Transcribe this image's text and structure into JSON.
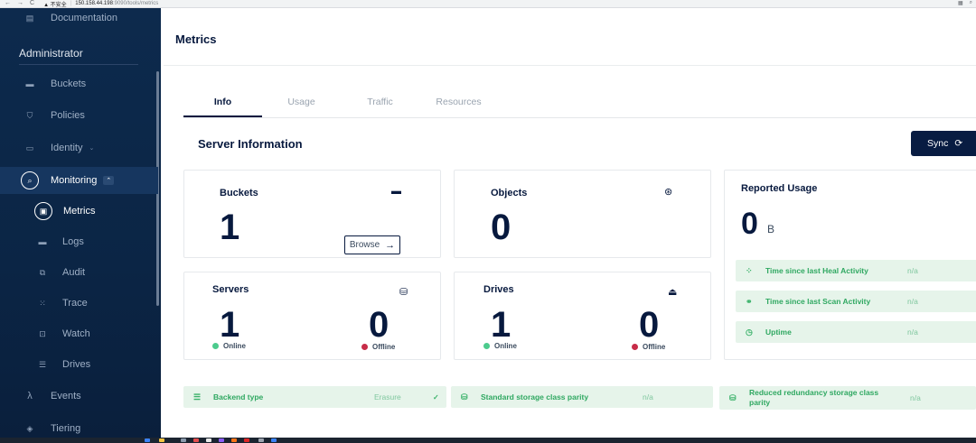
{
  "browser": {
    "nav_back": "←",
    "nav_forward": "→",
    "nav_reload": "C",
    "warning": "▲ 不安全",
    "host": "150.158.44.198",
    "path": ":9090/tools/metrics"
  },
  "sidebar": {
    "documentation": "Documentation",
    "section_label": "Administrator",
    "items": [
      {
        "label": "Buckets",
        "icon": "bucket-icon"
      },
      {
        "label": "Policies",
        "icon": "shield-icon"
      },
      {
        "label": "Identity",
        "icon": "id-card-icon"
      },
      {
        "label": "Monitoring",
        "icon": "search-icon"
      }
    ],
    "monitoring_sub": [
      {
        "label": "Metrics",
        "icon": "metrics-icon"
      },
      {
        "label": "Logs",
        "icon": "logs-icon"
      },
      {
        "label": "Audit",
        "icon": "audit-icon"
      },
      {
        "label": "Trace",
        "icon": "trace-icon"
      },
      {
        "label": "Watch",
        "icon": "watch-icon"
      },
      {
        "label": "Drives",
        "icon": "drives-icon"
      }
    ],
    "events": "Events",
    "tiering": "Tiering"
  },
  "main": {
    "title": "Metrics",
    "tabs": [
      "Info",
      "Usage",
      "Traffic",
      "Resources"
    ],
    "section_title": "Server Information",
    "sync_label": "Sync",
    "buckets": {
      "title": "Buckets",
      "value": "1",
      "browse": "Browse"
    },
    "objects": {
      "title": "Objects",
      "value": "0"
    },
    "servers": {
      "title": "Servers",
      "online": "1",
      "offline": "0",
      "online_label": "Online",
      "offline_label": "Offline"
    },
    "drives": {
      "title": "Drives",
      "online": "1",
      "offline": "0",
      "online_label": "Online",
      "offline_label": "Offline"
    },
    "reported": {
      "title": "Reported Usage",
      "value": "0",
      "unit": "B",
      "rows": [
        {
          "label": "Time since last Heal Activity",
          "value": "n/a"
        },
        {
          "label": "Time since last Scan Activity",
          "value": "n/a"
        },
        {
          "label": "Uptime",
          "value": "n/a"
        }
      ]
    },
    "footer": {
      "backend_label": "Backend type",
      "backend_value": "Erasure",
      "standard_label": "Standard storage class parity",
      "standard_value": "n/a",
      "reduced_label": "Reduced redundancy storage class parity",
      "reduced_value": "n/a"
    }
  },
  "colors": {
    "accent": "#081c42",
    "online": "#4ccb8d",
    "offline": "#c72c48",
    "sidebar": "#0b2545"
  }
}
